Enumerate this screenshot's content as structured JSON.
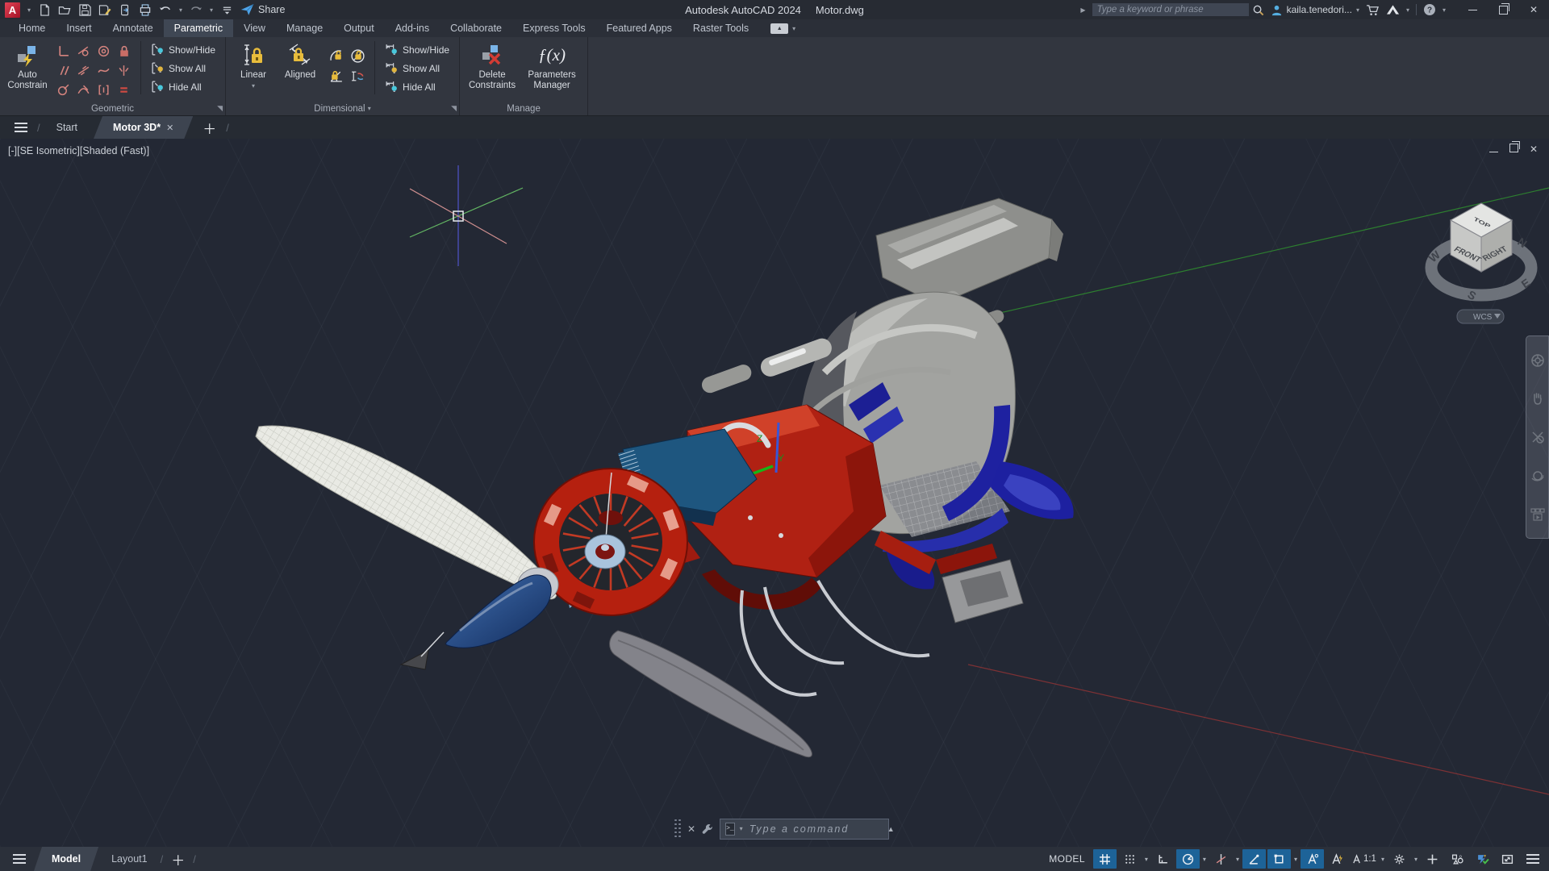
{
  "title_bar": {
    "app_button": "A",
    "qat_icons": [
      "new-file",
      "open-file",
      "save",
      "save-as",
      "open-from-web",
      "plot",
      "undo",
      "redo",
      "customize-qat"
    ],
    "share_label": "Share",
    "title_app": "Autodesk AutoCAD 2024",
    "title_doc": "Motor.dwg",
    "search_placeholder": "Type a keyword or phrase",
    "user_name": "kaila.tenedori..."
  },
  "ribbon_tabs": [
    "Home",
    "Insert",
    "Annotate",
    "Parametric",
    "View",
    "Manage",
    "Output",
    "Add-ins",
    "Collaborate",
    "Express Tools",
    "Featured Apps",
    "Raster Tools"
  ],
  "active_tab": "Parametric",
  "ribbon": {
    "geometric": {
      "label": "Geometric",
      "auto1": "Auto",
      "auto2": "Constrain",
      "show_hide": "Show/Hide",
      "show_all": "Show All",
      "hide_all": "Hide All"
    },
    "dimensional": {
      "label": "Dimensional",
      "linear": "Linear",
      "aligned": "Aligned",
      "show_hide": "Show/Hide",
      "show_all": "Show All",
      "hide_all": "Hide All"
    },
    "manage": {
      "label": "Manage",
      "delete1": "Delete",
      "delete2": "Constraints",
      "params1": "Parameters",
      "params2": "Manager",
      "fx": "ƒ(x)"
    }
  },
  "file_tabs": {
    "start": "Start",
    "doc": "Motor 3D*"
  },
  "viewport": {
    "label": "[-][SE Isometric][Shaded (Fast)]",
    "viewcube": {
      "top": "TOP",
      "front": "FRONT",
      "right": "RIGHT",
      "n": "N",
      "e": "E",
      "s": "S",
      "w": "W",
      "wcs": "WCS"
    },
    "navbar_icons": [
      "navigation-wheel",
      "pan",
      "zoom",
      "orbit",
      "show-motion"
    ],
    "command_placeholder": "Type a command"
  },
  "drawing_tabs": {
    "model": "Model",
    "layout1": "Layout1"
  },
  "status_bar": {
    "model_label": "MODEL",
    "annotation_scale": "1:1",
    "icons": [
      "grid",
      "snap-mode",
      "ortho",
      "polar-tracking",
      "isometric-drafting",
      "object-snap-tracking",
      "object-snap",
      "annotation-visibility",
      "annotation-autoscale",
      "annotation-scale",
      "workspace-switching",
      "plus",
      "isolate-objects",
      "graphics-performance",
      "clean-screen",
      "customization"
    ],
    "toggled_on": [
      "grid",
      "polar-tracking",
      "object-snap-tracking",
      "object-snap",
      "annotation-visibility"
    ]
  },
  "colors": {
    "accent_blue": "#1d6398",
    "brand_red": "#c5303e",
    "viewport_bg": "#232834",
    "ribbon_bg": "#32363f",
    "lock_yellow": "#e8bc3c",
    "constraint_salmon": "#d4837e"
  }
}
